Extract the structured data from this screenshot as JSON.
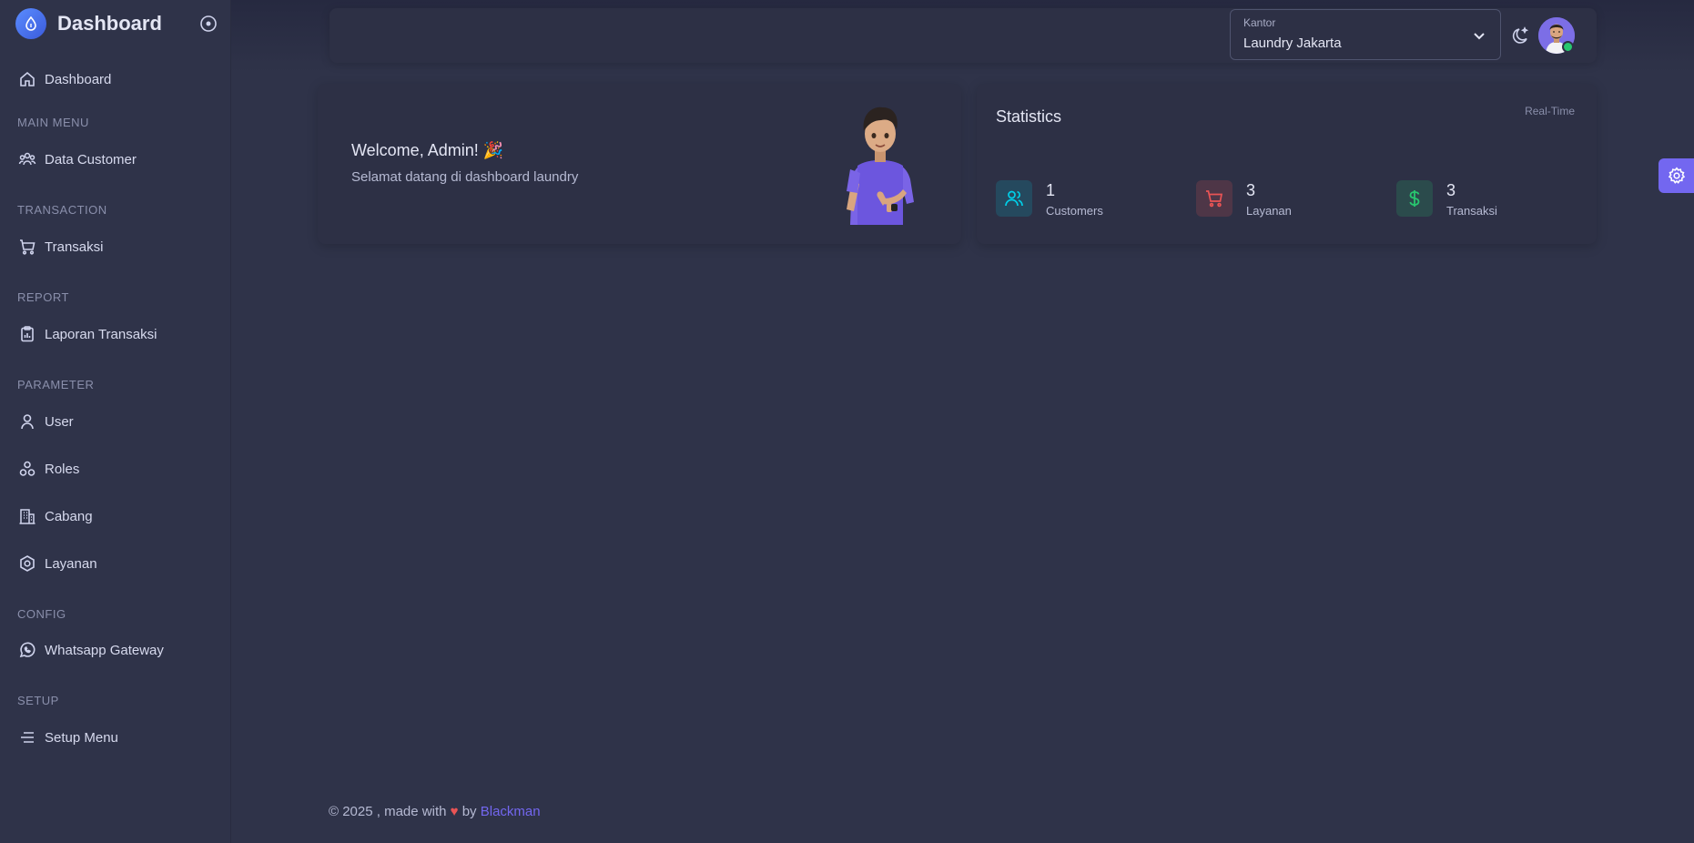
{
  "brand": {
    "title": "Dashboard"
  },
  "sidebar": {
    "dashboard": "Dashboard",
    "sections": {
      "main_menu": "MAIN MENU",
      "transaction": "TRANSACTION",
      "report": "REPORT",
      "parameter": "PARAMETER",
      "config": "CONFIG",
      "setup": "SETUP"
    },
    "items": {
      "data_customer": "Data Customer",
      "transaksi": "Transaksi",
      "laporan": "Laporan Transaksi",
      "user": "User",
      "roles": "Roles",
      "cabang": "Cabang",
      "layanan": "Layanan",
      "whatsapp": "Whatsapp Gateway",
      "setup_menu": "Setup Menu"
    }
  },
  "topbar": {
    "branch_caption": "Kantor",
    "branch_value": "Laundry Jakarta"
  },
  "welcome": {
    "title": "Welcome, Admin! 🎉",
    "subtitle": "Selamat datang di dashboard laundry"
  },
  "statistics": {
    "title": "Statistics",
    "badge": "Real-Time",
    "items": [
      {
        "value": "1",
        "label": "Customers",
        "icon": "users-icon",
        "color": "#00cfe8"
      },
      {
        "value": "3",
        "label": "Layanan",
        "icon": "cart-icon",
        "color": "#ea5455"
      },
      {
        "value": "3",
        "label": "Transaksi",
        "icon": "dollar-icon",
        "color": "#28c76f"
      }
    ]
  },
  "footer": {
    "prefix": "© 2025 , made with",
    "heart": "♥",
    "by": "by",
    "author": "Blackman"
  },
  "colors": {
    "background": "#2f3349",
    "card": "#2d3045",
    "accent": "#7367f0"
  }
}
